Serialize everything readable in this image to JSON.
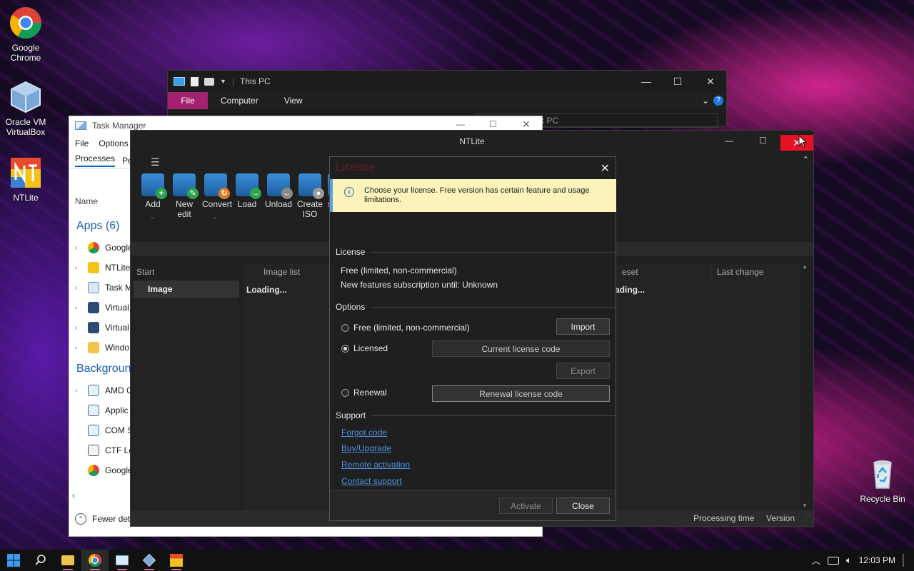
{
  "desktop": {
    "icons": [
      {
        "label": "Google Chrome"
      },
      {
        "label": "Oracle VM VirtualBox"
      },
      {
        "label": "NTLite"
      },
      {
        "label": "Recycle Bin"
      }
    ]
  },
  "explorer": {
    "title": "This PC",
    "tabs": [
      "File",
      "Computer",
      "View"
    ],
    "address_tail": "s PC"
  },
  "taskmanager": {
    "title": "Task Manager",
    "menu": [
      "File",
      "Options"
    ],
    "tabs": [
      "Processes",
      "Pe"
    ],
    "column_name": "Name",
    "apps_header": "Apps (6)",
    "apps": [
      "Google",
      "NTLite",
      "Task M",
      "Virtual",
      "Virtual",
      "Windo"
    ],
    "background_header": "Backgroun",
    "background": [
      "AMD C",
      "Applic",
      "COM S",
      "CTF Lo",
      "Google"
    ],
    "footer": "Fewer det"
  },
  "ntlite": {
    "title": "NTLite",
    "toolbar": [
      {
        "label": "Add",
        "badge": "+",
        "badge_color": "#2da44e"
      },
      {
        "label": "New edit",
        "badge": "✎",
        "badge_color": "#2da44e"
      },
      {
        "label": "Convert",
        "badge": "↻",
        "badge_color": "#e07a2a"
      },
      {
        "label": "Load",
        "badge": "→",
        "badge_color": "#2da44e"
      },
      {
        "label": "Unload",
        "badge": "←",
        "badge_color": "#8a8a8a"
      },
      {
        "label": "Create ISO",
        "badge": "●",
        "badge_color": "#9a9a9a"
      },
      {
        "label": "se",
        "badge": "",
        "badge_color": "#1d5e9e"
      }
    ],
    "sidebar_header": "Start",
    "sidebar_item": "Image",
    "columns": {
      "image_list": "Image list",
      "preset": "eset",
      "last_change": "Last change"
    },
    "loading": "Loading...",
    "loading_right": "ading...",
    "status": {
      "processing_time": "Processing time",
      "version": "Version"
    }
  },
  "license_dialog": {
    "title": "License",
    "banner": "Choose your license. Free version has certain feature and usage limitations.",
    "license_section": "License",
    "license_type": "Free (limited, non-commercial)",
    "subscription": "New features subscription until: Unknown",
    "options_section": "Options",
    "option_free": "Free (limited, non-commercial)",
    "option_licensed": "Licensed",
    "option_renewal": "Renewal",
    "selected_option": "Licensed",
    "import_btn": "Import",
    "current_code_placeholder": "Current license code",
    "export_btn": "Export",
    "renewal_code_placeholder": "Renewal license code",
    "support_section": "Support",
    "links": [
      "Forgot code",
      "Buy/Upgrade",
      "Remote activation",
      "Contact support"
    ],
    "activate_btn": "Activate",
    "close_btn": "Close"
  },
  "taskbar": {
    "clock": "12:03 PM"
  },
  "colors": {
    "accent_pink": "#a3216e",
    "close_red": "#e81123",
    "link_blue": "#4f8fe0",
    "banner_yellow": "#fbf3b9"
  }
}
